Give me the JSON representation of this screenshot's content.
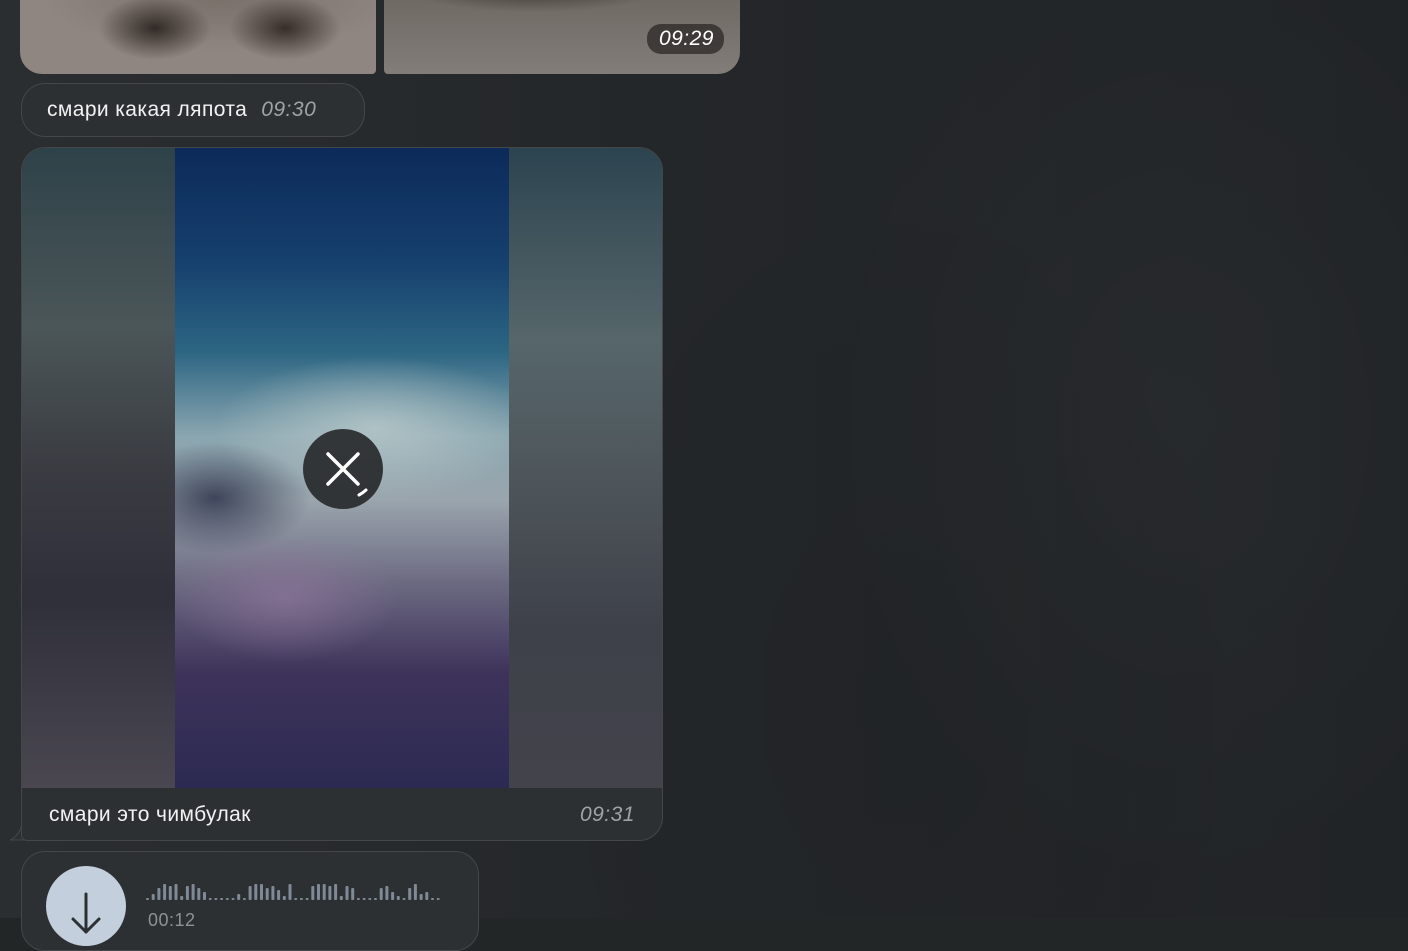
{
  "album": {
    "time": "09:29"
  },
  "messages": {
    "text1": {
      "text": "смари какая ляпота",
      "time": "09:30"
    },
    "media": {
      "caption": "смари это чимбулак",
      "time": "09:31",
      "cancel_icon": "close-icon"
    },
    "voice": {
      "duration": "00:12",
      "download_icon": "arrow-down-icon"
    }
  },
  "colors": {
    "background": "#232627",
    "bubble": "#2d3032",
    "bubble_border": "#43474a",
    "time_text": "#9ea3a7",
    "voice_button": "#c4cfdd",
    "waveform": "#7f8a96"
  }
}
